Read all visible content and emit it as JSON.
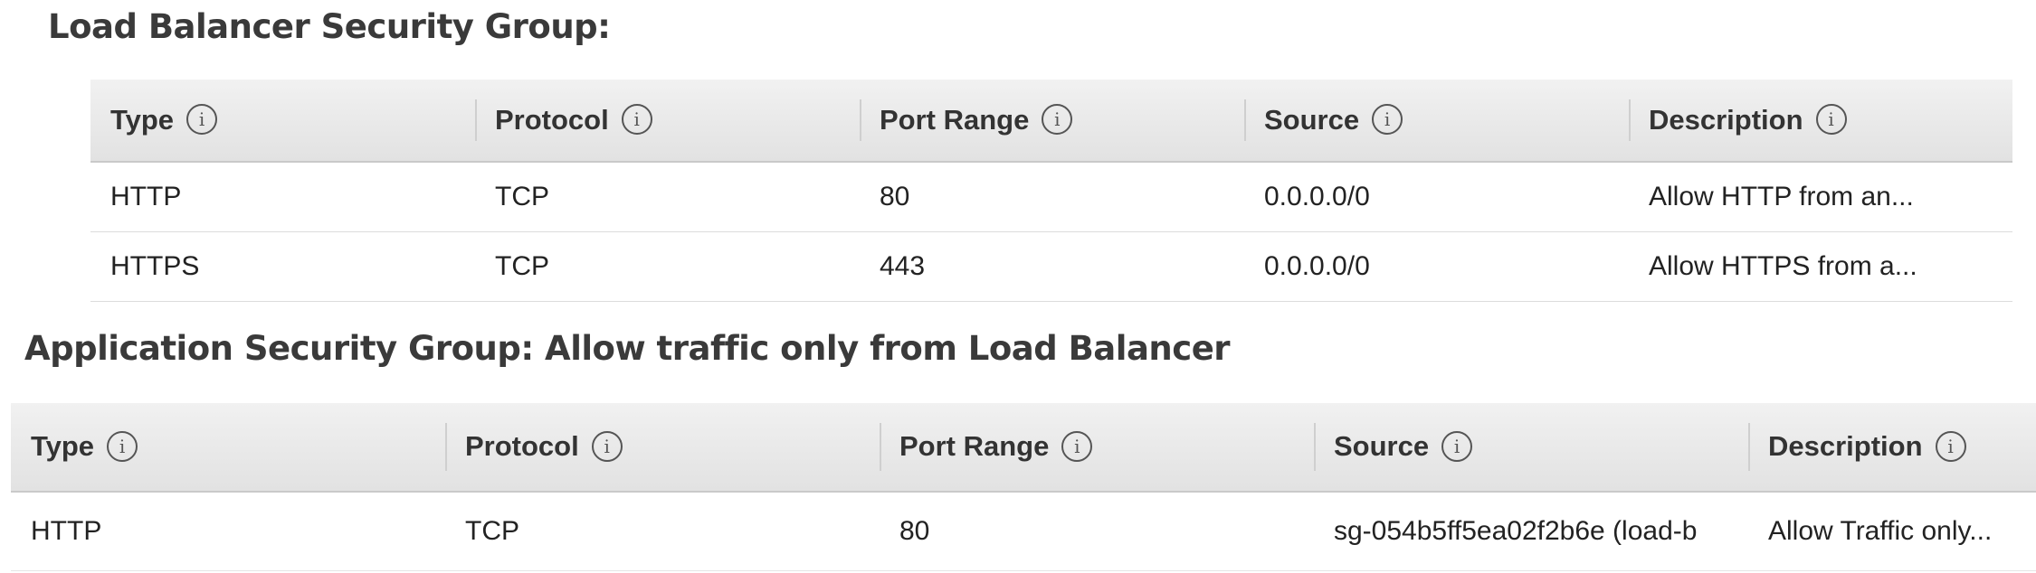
{
  "load_balancer": {
    "title": "Load Balancer Security Group:",
    "columns": [
      {
        "label": "Type",
        "icon": "info-icon"
      },
      {
        "label": "Protocol",
        "icon": "info-icon"
      },
      {
        "label": "Port Range",
        "icon": "info-icon"
      },
      {
        "label": "Source",
        "icon": "info-icon"
      },
      {
        "label": "Description",
        "icon": "info-icon"
      }
    ],
    "rows": [
      {
        "type": "HTTP",
        "protocol": "TCP",
        "port_range": "80",
        "source": "0.0.0.0/0",
        "description": "Allow HTTP from an..."
      },
      {
        "type": "HTTPS",
        "protocol": "TCP",
        "port_range": "443",
        "source": "0.0.0.0/0",
        "description": "Allow HTTPS from a..."
      }
    ]
  },
  "application": {
    "title": "Application Security Group: Allow traffic only from Load Balancer",
    "columns": [
      {
        "label": "Type",
        "icon": "info-icon"
      },
      {
        "label": "Protocol",
        "icon": "info-icon"
      },
      {
        "label": "Port Range",
        "icon": "info-icon"
      },
      {
        "label": "Source",
        "icon": "info-icon"
      },
      {
        "label": "Description",
        "icon": "info-icon"
      }
    ],
    "rows": [
      {
        "type": "HTTP",
        "protocol": "TCP",
        "port_range": "80",
        "source": "sg-054b5ff5ea02f2b6e (load-b",
        "description": "Allow Traffic only..."
      }
    ]
  },
  "info_icon_glyph": "i"
}
